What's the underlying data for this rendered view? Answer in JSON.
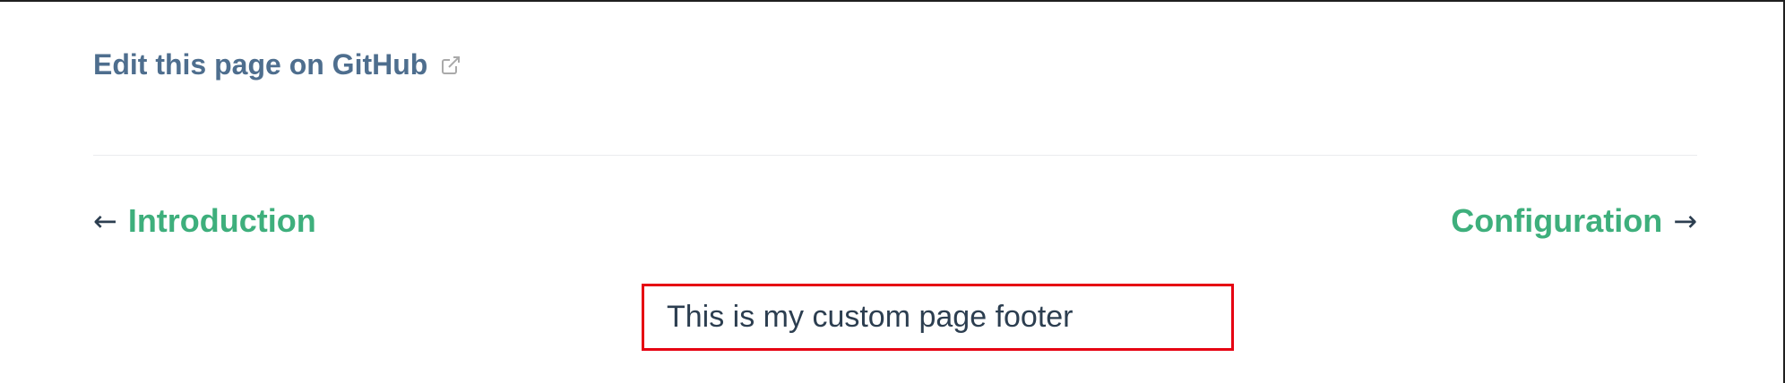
{
  "edit_link": {
    "label": "Edit this page on GitHub",
    "icon": "external-link-icon"
  },
  "page_nav": {
    "prev": {
      "arrow": "←",
      "label": "Introduction"
    },
    "next": {
      "label": "Configuration",
      "arrow": "→"
    }
  },
  "footer": {
    "text": "This is my custom page footer",
    "highlight_color": "#e60012"
  },
  "colors": {
    "link_green": "#3eaf7c",
    "edit_link_blue": "#4e6e8e",
    "text_dark": "#2c3e50",
    "divider": "#eaecef"
  }
}
